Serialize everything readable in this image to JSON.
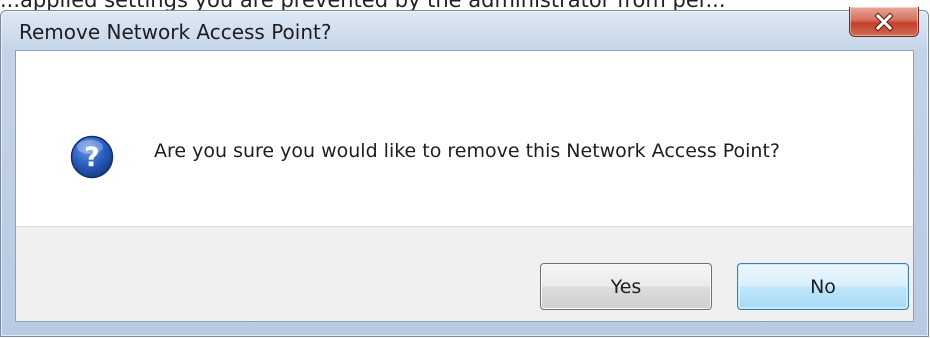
{
  "background": {
    "cropped_text": "...applied settings you are prevented by the administrator from per..."
  },
  "window": {
    "title": "Remove Network Access Point?"
  },
  "message": {
    "text": "Are you sure you would like to remove this Network Access Point?",
    "icon": "question-icon"
  },
  "buttons": {
    "yes_label": "Yes",
    "no_label": "No"
  },
  "icons": {
    "close": "close-icon",
    "question": "question-icon"
  },
  "colors": {
    "close_button_red": "#c2402c",
    "question_icon_blue": "#1f4fa6",
    "default_button_border": "#3c7fb1",
    "button_area_bg": "#f0f0f0"
  }
}
